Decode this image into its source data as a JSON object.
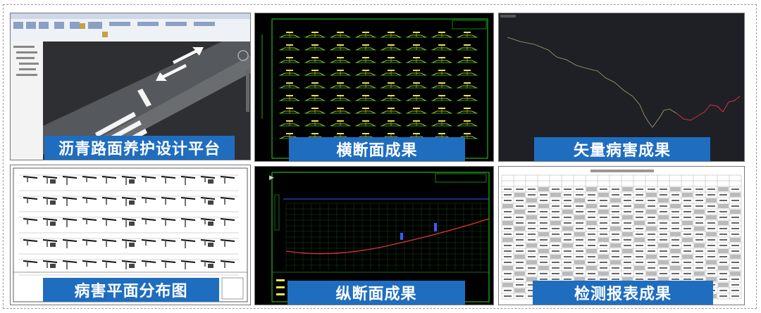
{
  "panels": {
    "p1": {
      "label": "沥青路面养护设计平台"
    },
    "p2": {
      "label": "横断面成果"
    },
    "p3": {
      "label": "矢量病害成果"
    },
    "p4": {
      "label": "病害平面分布图"
    },
    "p5": {
      "label": "纵断面成果"
    },
    "p6": {
      "label": "检测报表成果"
    }
  },
  "colors": {
    "label_bg": "#1f6dbf",
    "cad_bg": "#000000",
    "cad_green": "#27d627",
    "cad_yellow": "#e6e64a",
    "profile_red": "#e0303a",
    "profile_blue": "#3a5bff"
  }
}
